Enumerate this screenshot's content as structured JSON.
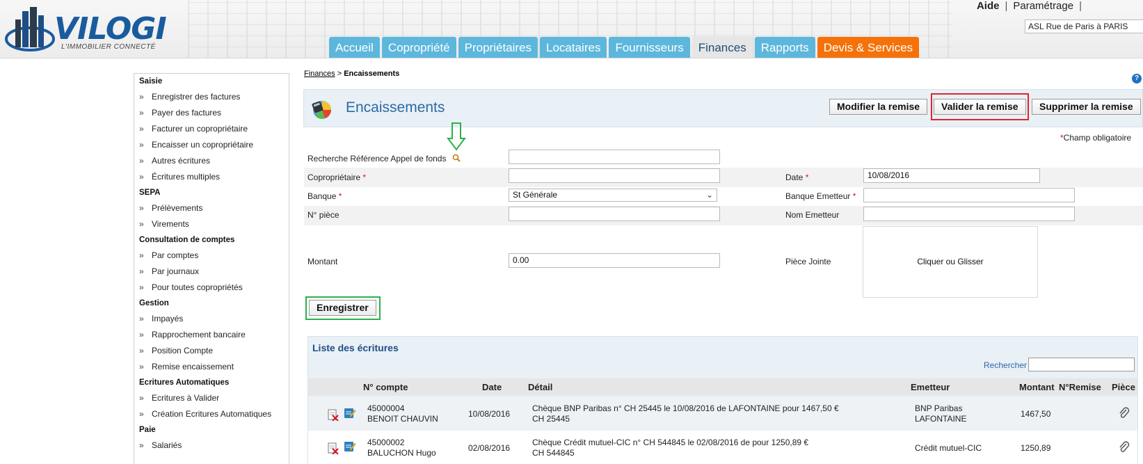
{
  "header": {
    "logo_text": "VILOGI",
    "logo_tagline": "L'IMMOBILIER CONNECTÉ",
    "help_link": "Aide",
    "link_separator": "|",
    "settings_link": "Paramétrage",
    "site_selected": "ASL Rue de Paris à PARIS",
    "tabs": [
      {
        "label": "Accueil"
      },
      {
        "label": "Copropriété"
      },
      {
        "label": "Propriétaires"
      },
      {
        "label": "Locataires"
      },
      {
        "label": "Fournisseurs"
      },
      {
        "label": "Finances"
      },
      {
        "label": "Rapports"
      },
      {
        "label": "Devis & Services"
      }
    ],
    "active_tab": "Finances"
  },
  "sidebar": {
    "groups": [
      {
        "title": "Saisie",
        "items": [
          "Enregistrer des factures",
          "Payer des factures",
          "Facturer un copropriétaire",
          "Encaisser un copropriétaire",
          "Autres écritures",
          "Écritures multiples"
        ]
      },
      {
        "title": "SEPA",
        "items": [
          "Prélèvements",
          "Virements"
        ]
      },
      {
        "title": "Consultation de comptes",
        "items": [
          "Par comptes",
          "Par journaux",
          "Pour toutes copropriétés"
        ]
      },
      {
        "title": "Gestion",
        "items": [
          "Impayés",
          "Rapprochement bancaire",
          "Position Compte",
          "Remise encaissement"
        ]
      },
      {
        "title": "Ecritures Automatiques",
        "items": [
          "Ecritures à Valider",
          "Création Ecritures Automatiques"
        ]
      },
      {
        "title": "Paie",
        "items": [
          "Salariés"
        ]
      }
    ],
    "bullet": "»"
  },
  "breadcrumb": {
    "parent": "Finances",
    "separator": ">",
    "current": "Encaissements"
  },
  "help_icon": "?",
  "panel": {
    "title": "Encaissements",
    "buttons": {
      "modify": "Modifier la remise",
      "validate": "Valider la remise",
      "delete": "Supprimer la remise"
    },
    "required_star": "*",
    "required_note": "Champ obligatoire"
  },
  "form": {
    "ref_label": "Recherche Référence Appel de fonds",
    "ref_value": "",
    "owner_label": "Copropriétaire",
    "owner_value": "",
    "date_label": "Date",
    "date_value": "10/08/2016",
    "bank_label": "Banque",
    "bank_value": "St Générale",
    "issuer_bank_label": "Banque Emetteur",
    "issuer_bank_value": "",
    "piece_label": "N° pièce",
    "piece_value": "",
    "issuer_name_label": "Nom Emetteur",
    "issuer_name_value": "",
    "amount_label": "Montant",
    "amount_value": "0.00",
    "attachment_label": "Pièce Jointe",
    "dropzone_text": "Cliquer ou Glisser",
    "required_star": "*",
    "save_button": "Enregistrer"
  },
  "list": {
    "title": "Liste des écritures",
    "search_label": "Rechercher",
    "search_value": "",
    "columns": [
      "N° compte",
      "Date",
      "Détail",
      "Emetteur",
      "Montant",
      "N°Remise",
      "Pièce"
    ],
    "rows": [
      {
        "account": "45000004",
        "owner": "BENOIT CHAUVIN",
        "date": "10/08/2016",
        "detail_1": "Chèque BNP Paribas n° CH 25445 le 10/08/2016 de LAFONTAINE pour 1467,50 €",
        "detail_2": "CH 25445",
        "issuer_1": "BNP Paribas",
        "issuer_2": "LAFONTAINE",
        "amount": "1467,50"
      },
      {
        "account": "45000002",
        "owner": "BALUCHON Hugo",
        "date": "02/08/2016",
        "detail_1": "Chèque Crédit mutuel-CIC n° CH 544845 le 02/08/2016 de pour 1250,89 €",
        "detail_2": "CH 544845",
        "issuer_1": "Crédit mutuel-CIC",
        "issuer_2": "",
        "amount": "1250,89"
      }
    ]
  },
  "colors": {
    "tab_blue": "#5db7dc",
    "tab_orange": "#f5720a",
    "title_blue": "#2b6aa3",
    "highlight_red": "#e0252b",
    "highlight_green": "#2bb14a"
  }
}
